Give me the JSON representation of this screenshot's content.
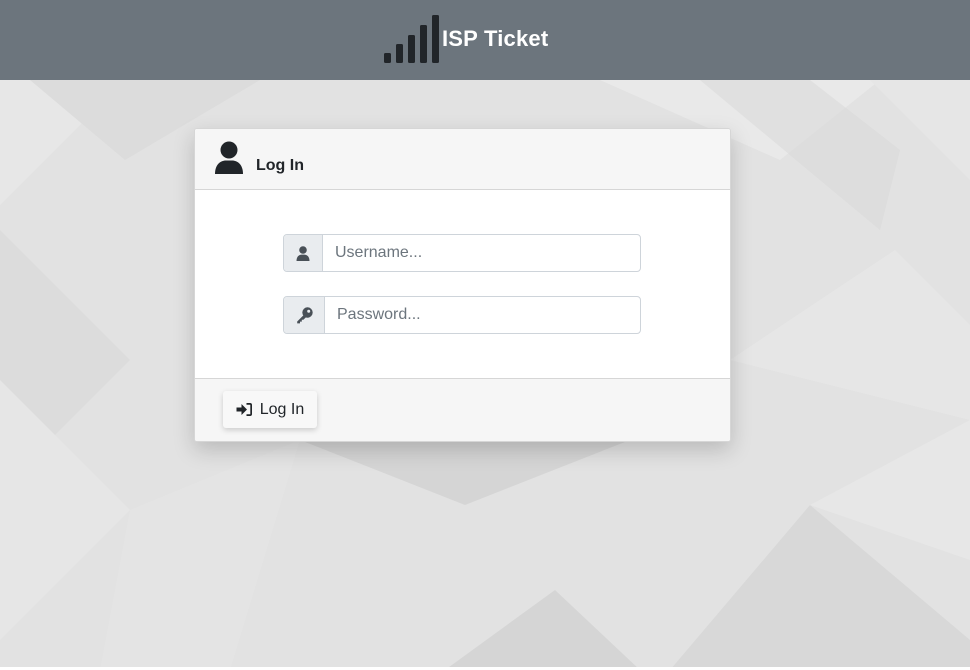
{
  "header": {
    "brand_name": "ISP Ticket",
    "logo_icon": "signal-bars-icon"
  },
  "login_card": {
    "title": "Log In",
    "title_icon": "user-icon",
    "username": {
      "icon": "user-icon",
      "placeholder": "Username...",
      "value": ""
    },
    "password": {
      "icon": "key-icon",
      "placeholder": "Password...",
      "value": ""
    },
    "submit": {
      "icon": "sign-in-icon",
      "label": "Log In"
    }
  },
  "colors": {
    "header_bg": "#6c757d",
    "page_bg": "#e2e2e2",
    "card_header_bg": "#f6f6f6",
    "input_addon_bg": "#e9ecef",
    "text_dark": "#212529"
  }
}
